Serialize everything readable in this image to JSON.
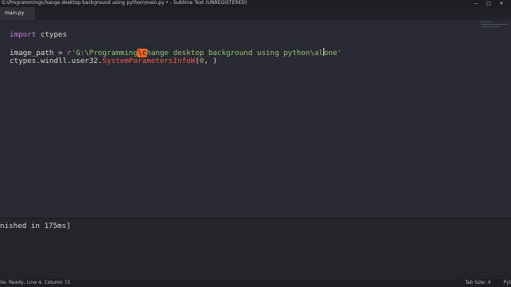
{
  "window": {
    "title": "G:\\Programming\\change desktop background using python\\main.py • - Sublime Text (UNREGISTERED)",
    "controls": [
      "—",
      "□",
      "✕"
    ]
  },
  "tabs": [
    {
      "label": "main.py"
    }
  ],
  "editor": {
    "line1": {
      "keyword": "import",
      "module": " ctypes"
    },
    "line3": {
      "var": "image_path = ",
      "prefix": "r",
      "str_a": "'G:\\Programming",
      "escape": "\\c",
      "str_b": "hange desktop background using python\\al",
      "str_c": "one'"
    },
    "line4": {
      "obj": "ctypes.windll.user32.",
      "func": "SystemParametersInfoW",
      "open": "(",
      "arg0": "0",
      "rest": ", )"
    }
  },
  "output": {
    "text": "nished in 175ms]"
  },
  "status": {
    "left": "ile: Ready, Line 4, Column 72",
    "tab_size": "Tab Size: 4",
    "syntax": "Pyt"
  },
  "colors": {
    "background": "#272a31",
    "keyword": "#c679dd",
    "string": "#98c379",
    "function": "#ef5b52",
    "number": "#d19a66",
    "escape_highlight": "#f0611e"
  }
}
